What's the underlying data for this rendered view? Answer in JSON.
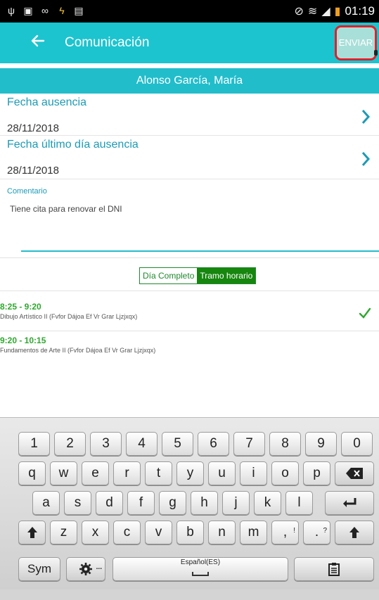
{
  "status_bar": {
    "time": "01:19",
    "left_icons": [
      "usb-icon",
      "image-icon",
      "voicemail-icon",
      "wifi-bolt-icon",
      "document-icon"
    ],
    "right_icons": [
      "mute-icon",
      "wifi-icon",
      "signal-icon",
      "battery-icon"
    ]
  },
  "app_bar": {
    "title": "Comunicación",
    "send_label": "ENVIAR",
    "accent_color": "#1cc4cf",
    "highlight_border_color": "#e0202a"
  },
  "name_band": {
    "name": "Alonso García, María"
  },
  "fields": [
    {
      "label": "Fecha ausencia",
      "value": "28/11/2018"
    },
    {
      "label": "Fecha último día ausencia",
      "value": "28/11/2018"
    }
  ],
  "comentario": {
    "label": "Comentario",
    "value": "Tiene cita para renovar el DNI"
  },
  "toggle": {
    "option_off": "Día Completo",
    "option_on": "Tramo horario",
    "selected": "Tramo horario"
  },
  "slots": [
    {
      "time": "8:25 - 9:20",
      "desc": "Dibujo Artístico II (Fvfor Dájoa Ef Vr Grar Ljzjxqx)",
      "checked": true
    },
    {
      "time": "9:20 - 10:15",
      "desc": "Fundamentos de Arte II (Fvfor Dájoa Ef Vr Grar Ljzjxqx)",
      "checked": false
    }
  ],
  "keyboard": {
    "row1": [
      "1",
      "2",
      "3",
      "4",
      "5",
      "6",
      "7",
      "8",
      "9",
      "0"
    ],
    "row2": [
      "q",
      "w",
      "e",
      "r",
      "t",
      "y",
      "u",
      "i",
      "o",
      "p"
    ],
    "row3": [
      "a",
      "s",
      "d",
      "f",
      "g",
      "h",
      "j",
      "k",
      "l"
    ],
    "row4": [
      "z",
      "x",
      "c",
      "v",
      "b",
      "n",
      "m"
    ],
    "punct1_main": ",",
    "punct1_sup": "!",
    "punct2_main": ".",
    "punct2_sup": "?",
    "sym_label": "Sym",
    "settings_sup": "...",
    "space_label": "Español(ES)"
  }
}
